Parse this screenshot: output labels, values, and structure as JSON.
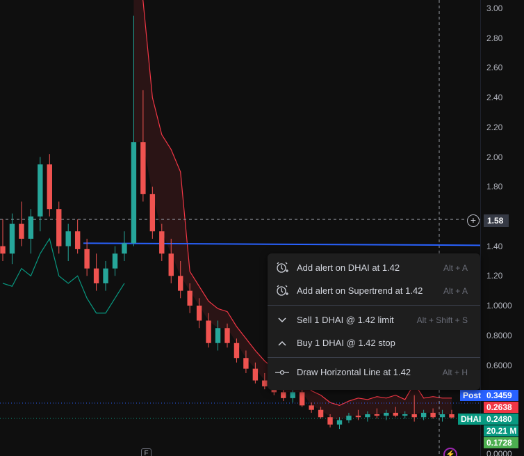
{
  "price_axis": {
    "ticks": [
      {
        "price": 3.0,
        "label": "3.00"
      },
      {
        "price": 2.8,
        "label": "2.80"
      },
      {
        "price": 2.6,
        "label": "2.60"
      },
      {
        "price": 2.4,
        "label": "2.40"
      },
      {
        "price": 2.2,
        "label": "2.20"
      },
      {
        "price": 2.0,
        "label": "2.00"
      },
      {
        "price": 1.8,
        "label": "1.80"
      },
      {
        "price": 1.4,
        "label": "1.40"
      },
      {
        "price": 1.2,
        "label": "1.20"
      },
      {
        "price": 1.0,
        "label": "1.0000"
      },
      {
        "price": 0.8,
        "label": "0.8000"
      },
      {
        "price": 0.6,
        "label": "0.6000"
      },
      {
        "price": 0.0,
        "label": "0.0000"
      }
    ],
    "crosshair_price": "1.58",
    "post_label": "Post",
    "post_price": "0.3459",
    "high_price": "0.2638",
    "symbol_tag": "DHAI",
    "last_price": "0.2480",
    "volume": "20.21 M",
    "low_price": "0.1728"
  },
  "colors": {
    "up": "#26a69a",
    "down": "#ef5350",
    "blue_line": "#2962ff",
    "post_blue": "#2962ff",
    "supertrend_red": "#f23645",
    "supertrend_green": "#089981"
  },
  "context_menu": {
    "items": [
      {
        "icon": "alarm-plus-icon",
        "label": "Add alert on DHAI at 1.42",
        "shortcut": "Alt + A"
      },
      {
        "icon": "alarm-plus-icon",
        "label": "Add alert on Supertrend at 1.42",
        "shortcut": "Alt + A"
      },
      {
        "icon": "chevron-down-icon",
        "label": "Sell 1 DHAI @ 1.42 limit",
        "shortcut": "Alt + Shift + S"
      },
      {
        "icon": "chevron-up-icon",
        "label": "Buy 1 DHAI @ 1.42 stop",
        "shortcut": ""
      },
      {
        "icon": "horizontal-line-icon",
        "label": "Draw Horizontal Line at 1.42",
        "shortcut": "Alt + H"
      }
    ]
  },
  "markers": {
    "financials_icon": "F",
    "flash_icon": "⚡"
  },
  "chart_data": {
    "type": "candlestick",
    "symbol": "DHAI",
    "horizontal_line_price": 1.42,
    "crosshair_price": 1.58,
    "candles": [
      {
        "o": 1.4,
        "h": 1.58,
        "l": 1.3,
        "c": 1.35
      },
      {
        "o": 1.35,
        "h": 1.62,
        "l": 1.28,
        "c": 1.55
      },
      {
        "o": 1.55,
        "h": 1.7,
        "l": 1.4,
        "c": 1.45
      },
      {
        "o": 1.45,
        "h": 1.65,
        "l": 1.35,
        "c": 1.6
      },
      {
        "o": 1.6,
        "h": 2.0,
        "l": 1.5,
        "c": 1.95
      },
      {
        "o": 1.95,
        "h": 2.02,
        "l": 1.6,
        "c": 1.65
      },
      {
        "o": 1.65,
        "h": 1.7,
        "l": 1.35,
        "c": 1.4
      },
      {
        "o": 1.4,
        "h": 1.55,
        "l": 1.3,
        "c": 1.5
      },
      {
        "o": 1.5,
        "h": 1.58,
        "l": 1.35,
        "c": 1.38
      },
      {
        "o": 1.38,
        "h": 1.45,
        "l": 1.2,
        "c": 1.25
      },
      {
        "o": 1.25,
        "h": 1.35,
        "l": 1.1,
        "c": 1.15
      },
      {
        "o": 1.15,
        "h": 1.3,
        "l": 1.1,
        "c": 1.25
      },
      {
        "o": 1.25,
        "h": 1.4,
        "l": 1.2,
        "c": 1.35
      },
      {
        "o": 1.35,
        "h": 1.5,
        "l": 1.3,
        "c": 1.42
      },
      {
        "o": 1.42,
        "h": 2.95,
        "l": 1.4,
        "c": 2.1
      },
      {
        "o": 2.1,
        "h": 2.45,
        "l": 1.7,
        "c": 1.75
      },
      {
        "o": 1.75,
        "h": 1.8,
        "l": 1.45,
        "c": 1.5
      },
      {
        "o": 1.5,
        "h": 1.55,
        "l": 1.3,
        "c": 1.35
      },
      {
        "o": 1.35,
        "h": 1.45,
        "l": 1.15,
        "c": 1.2
      },
      {
        "o": 1.2,
        "h": 1.3,
        "l": 1.05,
        "c": 1.1
      },
      {
        "o": 1.1,
        "h": 1.15,
        "l": 0.95,
        "c": 1.0
      },
      {
        "o": 1.0,
        "h": 1.05,
        "l": 0.85,
        "c": 0.9
      },
      {
        "o": 0.9,
        "h": 0.95,
        "l": 0.72,
        "c": 0.75
      },
      {
        "o": 0.75,
        "h": 0.9,
        "l": 0.7,
        "c": 0.85
      },
      {
        "o": 0.85,
        "h": 0.88,
        "l": 0.72,
        "c": 0.75
      },
      {
        "o": 0.75,
        "h": 0.78,
        "l": 0.62,
        "c": 0.65
      },
      {
        "o": 0.65,
        "h": 0.7,
        "l": 0.55,
        "c": 0.58
      },
      {
        "o": 0.58,
        "h": 0.62,
        "l": 0.48,
        "c": 0.5
      },
      {
        "o": 0.5,
        "h": 0.55,
        "l": 0.44,
        "c": 0.46
      },
      {
        "o": 0.46,
        "h": 0.5,
        "l": 0.4,
        "c": 0.42
      },
      {
        "o": 0.42,
        "h": 0.45,
        "l": 0.36,
        "c": 0.38
      },
      {
        "o": 0.38,
        "h": 0.45,
        "l": 0.35,
        "c": 0.42
      },
      {
        "o": 0.42,
        "h": 0.44,
        "l": 0.32,
        "c": 0.33
      },
      {
        "o": 0.33,
        "h": 0.35,
        "l": 0.28,
        "c": 0.3
      },
      {
        "o": 0.3,
        "h": 0.32,
        "l": 0.24,
        "c": 0.25
      },
      {
        "o": 0.25,
        "h": 0.27,
        "l": 0.18,
        "c": 0.2
      },
      {
        "o": 0.2,
        "h": 0.25,
        "l": 0.17,
        "c": 0.23
      },
      {
        "o": 0.23,
        "h": 0.28,
        "l": 0.21,
        "c": 0.26
      },
      {
        "o": 0.26,
        "h": 0.3,
        "l": 0.23,
        "c": 0.25
      },
      {
        "o": 0.25,
        "h": 0.29,
        "l": 0.22,
        "c": 0.27
      },
      {
        "o": 0.27,
        "h": 0.31,
        "l": 0.24,
        "c": 0.26
      },
      {
        "o": 0.26,
        "h": 0.3,
        "l": 0.23,
        "c": 0.28
      },
      {
        "o": 0.28,
        "h": 0.32,
        "l": 0.25,
        "c": 0.26
      },
      {
        "o": 0.26,
        "h": 0.29,
        "l": 0.24,
        "c": 0.27
      },
      {
        "o": 0.27,
        "h": 0.4,
        "l": 0.22,
        "c": 0.25
      },
      {
        "o": 0.25,
        "h": 0.3,
        "l": 0.23,
        "c": 0.28
      },
      {
        "o": 0.28,
        "h": 0.31,
        "l": 0.24,
        "c": 0.25
      },
      {
        "o": 0.25,
        "h": 0.3,
        "l": 0.22,
        "c": 0.27
      },
      {
        "o": 0.27,
        "h": 0.3,
        "l": 0.24,
        "c": 0.248
      }
    ]
  }
}
